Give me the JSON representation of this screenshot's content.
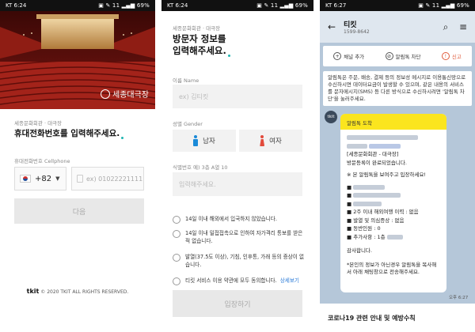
{
  "status_bars": [
    {
      "time": "KT 6:24",
      "right": "▣ ✎ 11 ▂▄▆ 69%"
    },
    {
      "time": "KT 6:24",
      "right": "▣ ✎ 11 ▂▄▆ 69%"
    },
    {
      "time": "KT 6:27",
      "right": "▣ ✎ 11 ▂▄▆ 69%"
    }
  ],
  "screen1": {
    "hero_logo": "세종대극장",
    "venue": "세종문화회관 · 대극장",
    "heading": "휴대전화번호를 입력해주세요.",
    "phone_label": "휴대전화번호 Cellphone",
    "country_code": "+82",
    "phone_placeholder": "ex) 01022221111",
    "next_button": "다음",
    "footer_brand": "tkit",
    "footer_text": "© 2020 TKIT ALL RIGHTS RESERVED."
  },
  "screen2": {
    "venue": "세종문화회관 · 대극장",
    "heading_line1": "방문자 정보를",
    "heading_line2": "입력해주세요.",
    "name_label": "이름 Name",
    "name_placeholder": "ex) 김티킷",
    "gender_label": "성별 Gender",
    "male": "남자",
    "female": "여자",
    "id_label": "식별번호 예) 3층 A열 10",
    "id_placeholder": "입력해주세요.",
    "checks": [
      "14일 이내 해외에서 입국하지 않았습니다.",
      "14일 이내 밀접접촉으로 인하여 자가격리 통보를 받은적 없습니다.",
      "발열(37.5도 이상), 기침, 인후통, 가래 등의 증상이 없습니다.",
      "티킷 서비스 이용 약관에 모두 동의합니다."
    ],
    "see_more": "상세보기",
    "enter_button": "입장하기"
  },
  "screen3": {
    "chat_name": "티킷",
    "chat_number": "1599-8642",
    "actions": [
      "채널 추가",
      "알림톡 차단",
      "신고"
    ],
    "notice": "알림톡은 주문, 배송, 결제 등의 정보성 메시지로 이용통신망으로 수신하시면 데이터요금이 발생할 수 있으며, 같은 내용의 서비스를 문자메시지(SMS) 등 다른 방식으로 수신하시려면 '알림톡 차단'을 눌러주세요.",
    "avatar_label": "tkit",
    "bubble_title": "알림톡 도착",
    "msg_venue": "[세종문화회관 - 대극장]",
    "msg_done": "방문등록이 완료되었습니다.",
    "msg_show": "※ 본 알림톡을 보여주고 입장하세요!",
    "msg_travel": "■ 2주 이내 해외여행 이력 : 없음",
    "msg_fever": "■ 발열 및 의심증상 : 없음",
    "msg_contact": "■ 동반인원 : 0",
    "msg_extra": "■ 추가사항 : 1층",
    "msg_thanks": "감사합니다.",
    "msg_note": "*본인의 정보가 아닌경우 알림톡을 복사해서 아래 채팅창으로 전송해주세요.",
    "time": "오후 6:27",
    "bottom_bar": "코로나19 관련 안내 및 예방수칙"
  }
}
